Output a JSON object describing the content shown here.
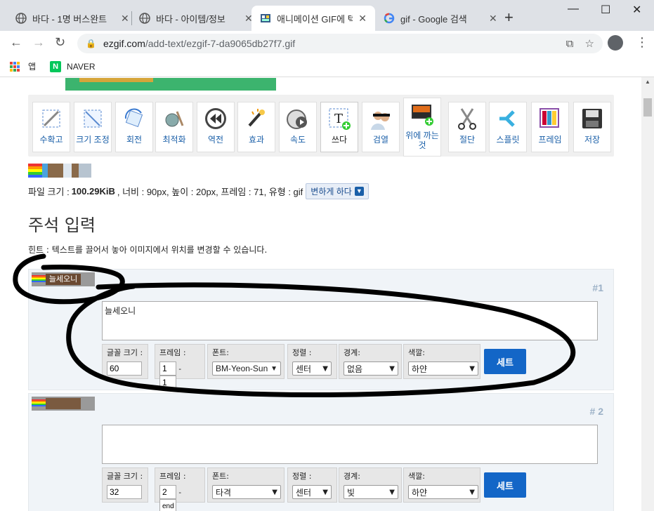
{
  "browser": {
    "tabs": [
      {
        "label": "바다 - 1명 버스완트",
        "active": false
      },
      {
        "label": "바다 - 아이템/정보",
        "active": false
      },
      {
        "label": "애니메이션 GIF에 텍",
        "active": true
      },
      {
        "label": "gif - Google 검색",
        "active": false
      }
    ],
    "url_host": "ezgif.com",
    "url_path": "/add-text/ezgif-7-da9065db27f7.gif",
    "bookmarks": [
      {
        "label": "앱"
      },
      {
        "label": "NAVER"
      }
    ]
  },
  "toolbar": {
    "tools": [
      {
        "label": "수확고",
        "icon": "crop-icon"
      },
      {
        "label": "크기 조정",
        "icon": "resize-icon"
      },
      {
        "label": "회전",
        "icon": "rotate-icon"
      },
      {
        "label": "최적화",
        "icon": "optimize-icon"
      },
      {
        "label": "역전",
        "icon": "reverse-icon"
      },
      {
        "label": "효과",
        "icon": "effects-icon"
      },
      {
        "label": "속도",
        "icon": "speed-icon"
      },
      {
        "label": "쓰다",
        "icon": "write-icon",
        "current": true
      },
      {
        "label": "검열",
        "icon": "censor-icon"
      },
      {
        "label": "위에 까는 것",
        "icon": "overlay-icon"
      },
      {
        "label": "절단",
        "icon": "cut-icon"
      },
      {
        "label": "스플릿",
        "icon": "split-icon"
      },
      {
        "label": "프레임",
        "icon": "frames-icon"
      },
      {
        "label": "저장",
        "icon": "save-icon"
      }
    ]
  },
  "file_info": {
    "size_label": "파일 크기 :",
    "size_value": "100.29KiB",
    "rest": ", 너비 : 90px, 높이 : 20px, 프레임 : 71, 유형 : gif",
    "change_label": "변하게 하다"
  },
  "section": {
    "title": "주석 입력",
    "hint": "힌트 : 텍스트를 끌어서 놓아 이미지에서 위치를 변경할 수 있습니다."
  },
  "frames": [
    {
      "number": "#1",
      "thumb_text": "늘세오니",
      "text": "늘세오니",
      "font_size_label": "글꼴 크기 :",
      "font_size": "60",
      "frame_label": "프레임 :",
      "frame_from": "1",
      "frame_to": "1",
      "font_label": "폰트:",
      "font": "BM-Yeon-Sung",
      "align_label": "정렬 :",
      "align": "센터",
      "border_label": "경계:",
      "border": "없음",
      "color_label": "색깔:",
      "color": "하얀",
      "set_label": "세트"
    },
    {
      "number": "# 2",
      "thumb_text": "",
      "text": "",
      "font_size_label": "글꼴 크기 :",
      "font_size": "32",
      "frame_label": "프레임 :",
      "frame_from": "2",
      "frame_to": "end",
      "font_label": "폰트:",
      "font": "타격",
      "align_label": "정렬 :",
      "align": "센터",
      "border_label": "경계:",
      "border": "빛",
      "color_label": "색깔:",
      "color": "하얀",
      "set_label": "세트"
    }
  ]
}
